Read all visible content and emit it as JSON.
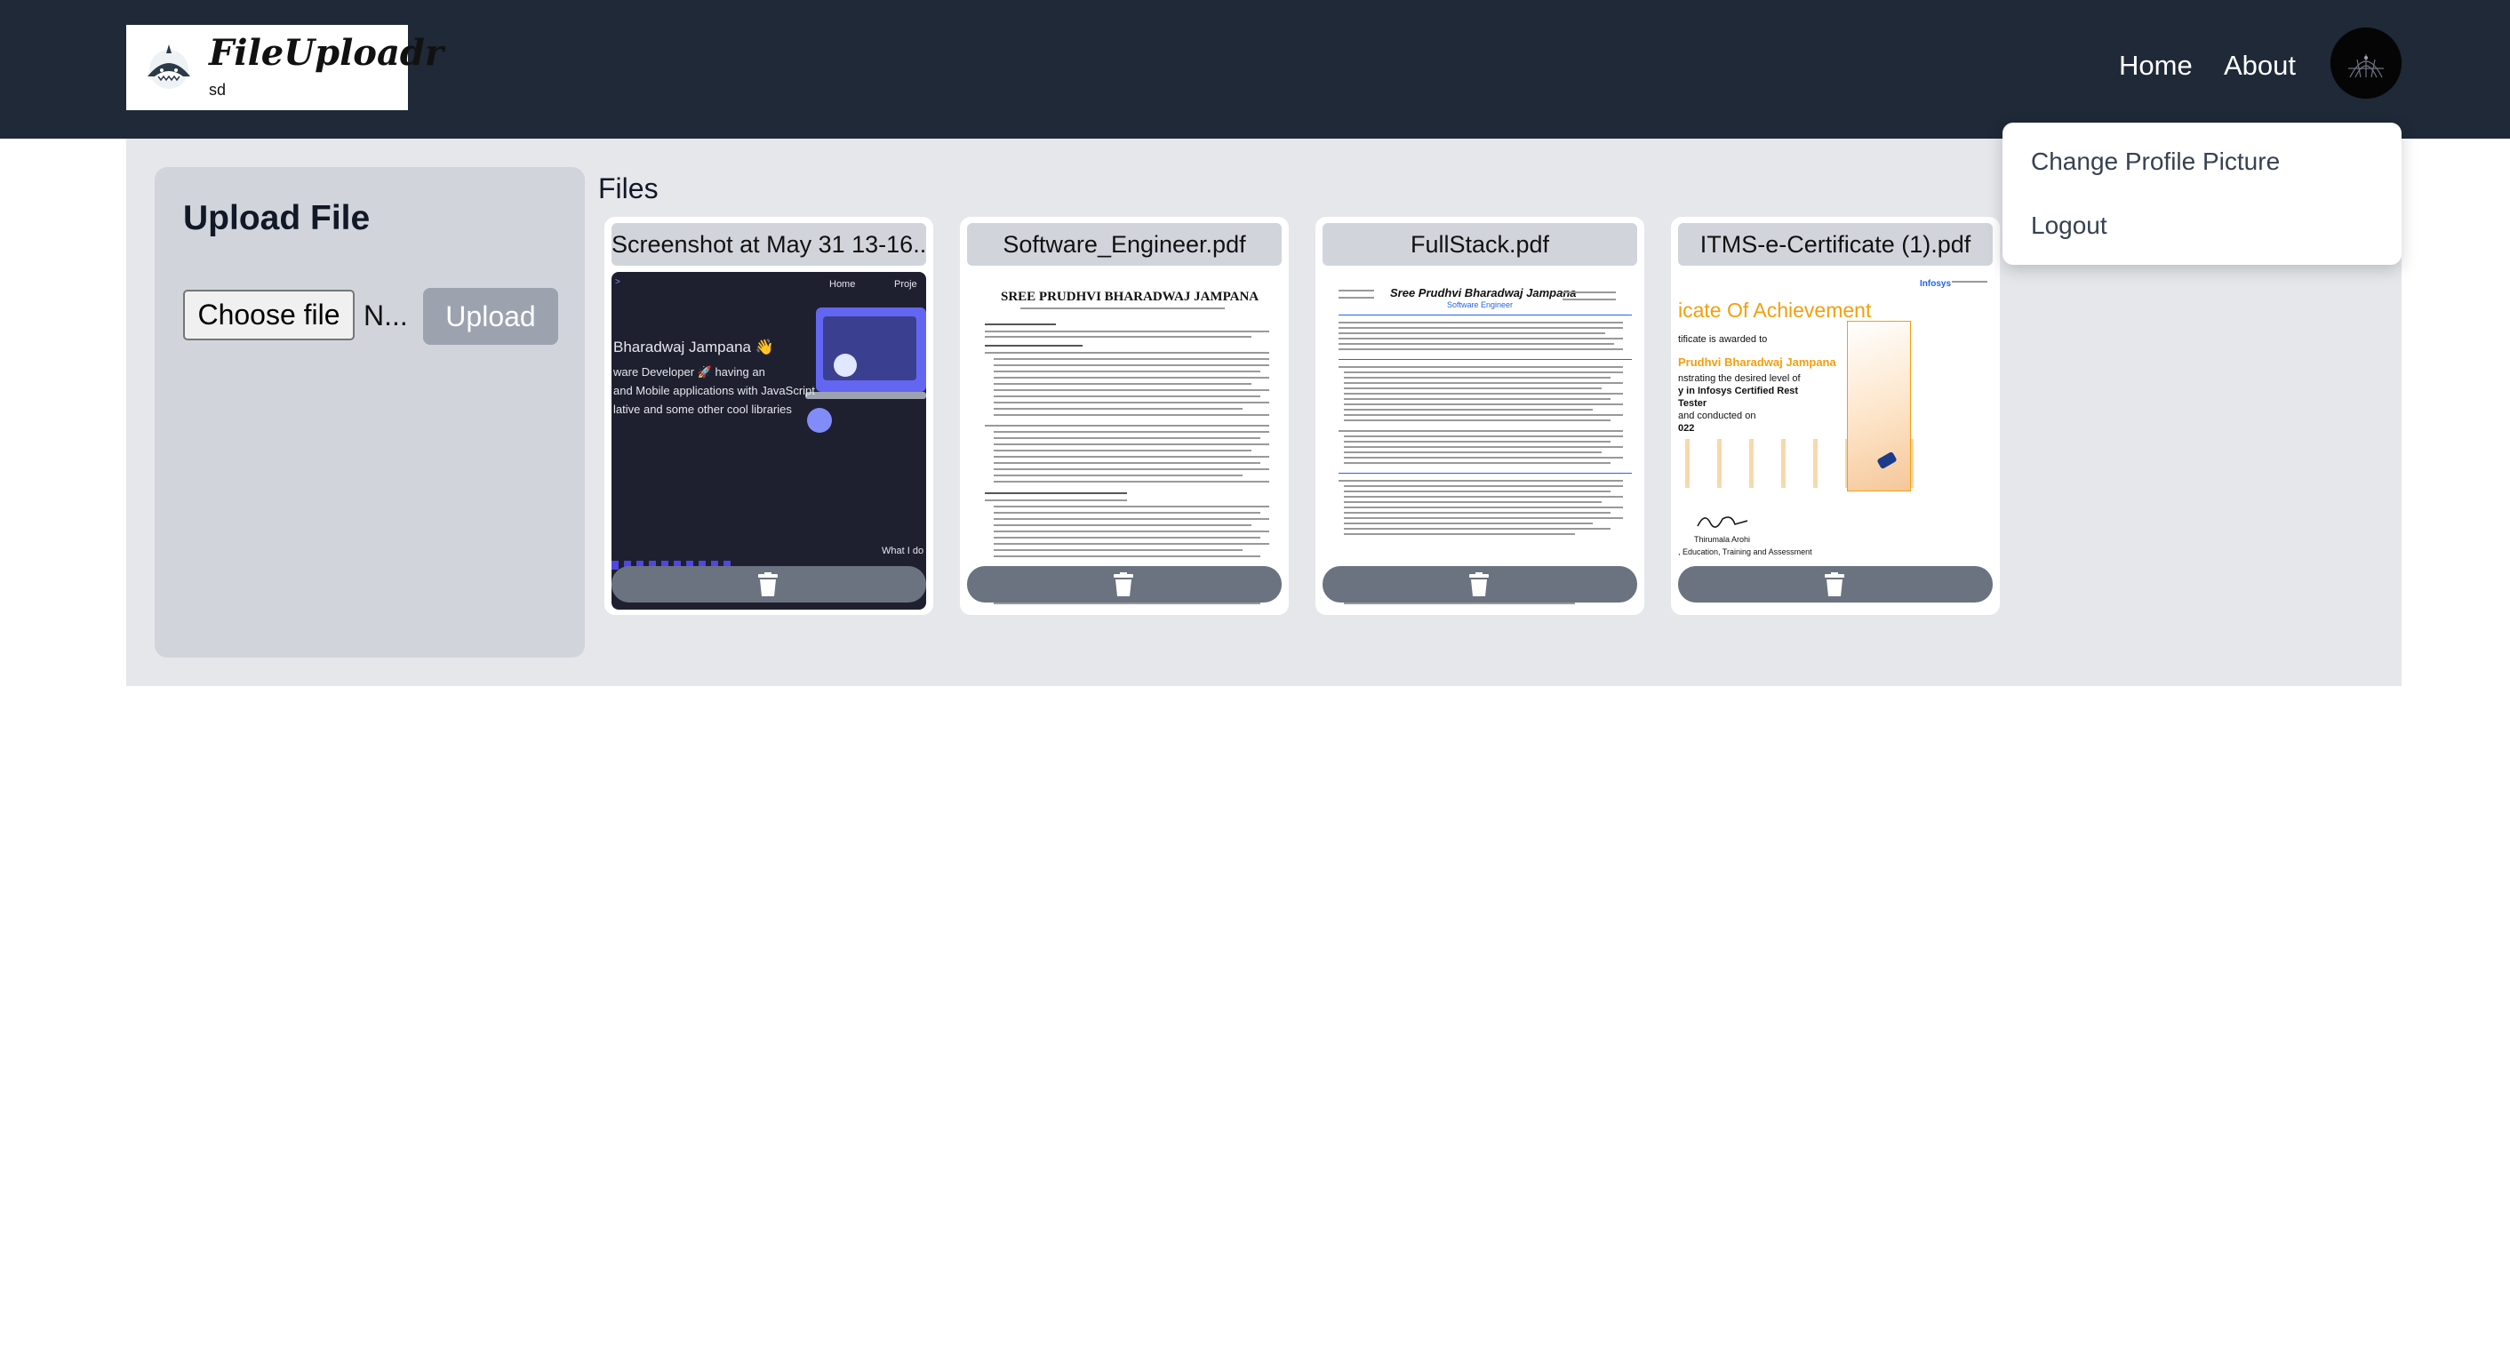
{
  "brand": {
    "title": "FileUploadr",
    "subtitle": "sd"
  },
  "nav": {
    "home": "Home",
    "about": "About"
  },
  "menu": {
    "change_picture": "Change Profile Picture",
    "logout": "Logout"
  },
  "upload": {
    "title": "Upload File",
    "choose_label": "Choose file",
    "file_status": "N...",
    "upload_label": "Upload"
  },
  "files": {
    "heading": "Files",
    "items": [
      {
        "name": "Screenshot at May 31 13-16...",
        "preview": {
          "nav_home": "Home",
          "nav_proj": "Proje",
          "line1": "Bharadwaj Jampana 👋",
          "line2": "ware Developer 🚀 having an",
          "line3": "and Mobile applications with JavaScript",
          "line4": "lative and some other cool libraries",
          "footer": "What I do"
        }
      },
      {
        "name": "Software_Engineer.pdf",
        "preview": {
          "heading": "SREE PRUDHVI BHARADWAJ JAMPANA"
        }
      },
      {
        "name": "FullStack.pdf",
        "preview": {
          "heading": "Sree Prudhvi Bharadwaj Jampana",
          "role": "Software Engineer"
        }
      },
      {
        "name": "ITMS-e-Certificate (1).pdf",
        "preview": {
          "title": "icate Of Achievement",
          "awarded": "tificate is awarded to",
          "name": "Prudhvi Bharadwaj Jampana",
          "line1": "nstrating the desired level of",
          "line2": "y in Infosys Certified Rest",
          "line3": "Tester",
          "line4": "and conducted on",
          "year": "022",
          "signer": "Thirumala Arohi",
          "dept": ", Education, Training and Assessment",
          "brand": "Infosys"
        }
      }
    ]
  },
  "colors": {
    "nav_bg": "#1f2937",
    "main_bg": "#e5e7eb",
    "panel_bg": "#d1d5db",
    "upload_btn": "#9ca3af",
    "delete_btn": "#6b7280"
  },
  "icons": {
    "delete": "trash-icon",
    "logo": "shark-icon"
  }
}
